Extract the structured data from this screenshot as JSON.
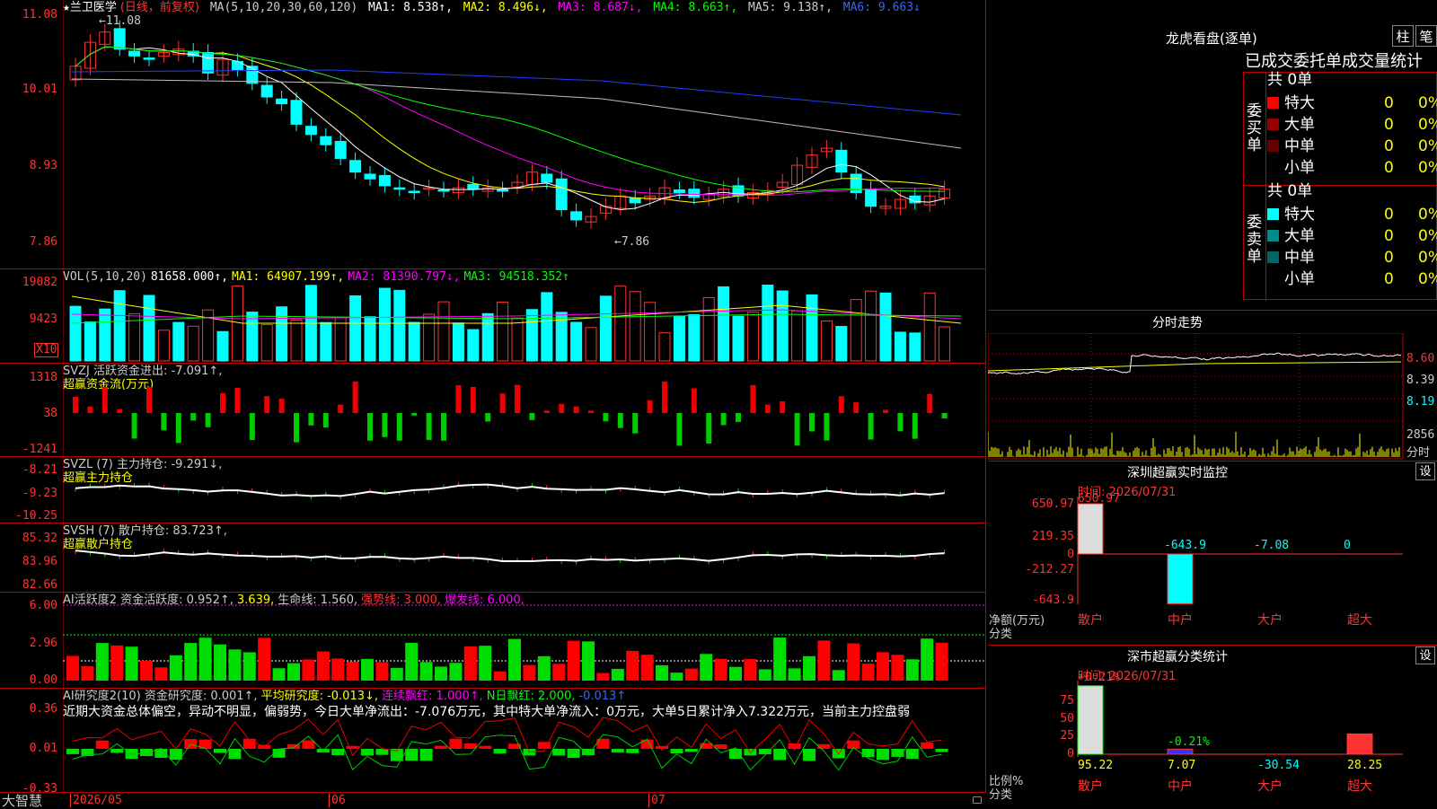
{
  "app": {
    "brand": "大智慧"
  },
  "stock": {
    "star": "★",
    "name": "兰卫医学",
    "period": "(日线，前复权)"
  },
  "main_chart": {
    "ma_label": "MA(5,10,20,30,60,120)",
    "ma1": "MA1: 8.538↑,",
    "ma2": "MA2: 8.496↓,",
    "ma3": "MA3: 8.687↓,",
    "ma4": "MA4: 8.663↑,",
    "ma5": "MA5: 9.138↑,",
    "ma6": "MA6: 9.663↓",
    "y_ticks": [
      "11.08",
      "10.01",
      "8.93",
      "7.86"
    ],
    "high_label": "←11.08",
    "low_label": "←7.86",
    "colors": {
      "up": "#ff3232",
      "down": "#00ffff",
      "ma1": "#ffffff",
      "ma2": "#ffff00",
      "ma3": "#ff00ff",
      "ma4": "#00ff00",
      "ma5": "#c0c0c0",
      "ma6": "#2040ff"
    }
  },
  "vol_chart": {
    "label": "VOL(5,10,20)",
    "v0": "81658.000↑,",
    "ma1": "MA1: 64907.199↑,",
    "ma2": "MA2: 81390.797↓,",
    "ma3": "MA3: 94518.352↑",
    "y_ticks": [
      "19082",
      "9423"
    ],
    "unit": "X10"
  },
  "svzj": {
    "label": "SVZJ  活跃资金进出: -7.091↑,",
    "sub": "超赢资金流(万元)",
    "y_ticks": [
      "1318",
      "38",
      "-1241"
    ]
  },
  "svzl": {
    "label": "SVZL (7) 主力持仓: -9.291↓,",
    "sub": "超赢主力持仓",
    "y_ticks": [
      "-8.21",
      "-9.23",
      "-10.25"
    ]
  },
  "svsh": {
    "label": "SVSH (7) 散户持仓: 83.723↑,",
    "sub": "超赢散户持仓",
    "y_ticks": [
      "85.32",
      "83.96",
      "82.66"
    ]
  },
  "ai_act": {
    "label": "AI活跃度2 资金活跃度: 0.952↑,",
    "v2": "3.639,",
    "v3": "生命线: 1.560,",
    "v4": "强势线: 3.000,",
    "v5": "爆发线: 6.000,",
    "y_ticks": [
      "6.00",
      "2.96",
      "0.00"
    ]
  },
  "ai_res": {
    "label": "AI研究度2(10) 资金研究度: 0.001↑,",
    "v2": "平均研究度: -0.013↓,",
    "v3": "连续飘红: 1.000↑,",
    "v4": "N日飘红: 2.000,",
    "v5": "-0.013↑",
    "summary": "近期大资金总体偏空，异动不明显，偏弱势，今日大单净流出：-7.076万元，其中特大单净流入：0万元，大单5日累计净入7.322万元，当前主力控盘弱",
    "y_ticks": [
      "0.36",
      "0.01",
      "-0.33"
    ]
  },
  "dates": [
    "2026/05",
    "06",
    "07"
  ],
  "dragon": {
    "title": "龙虎看盘(逐单)",
    "btn1": "柱",
    "btn2": "笔",
    "tabs": [
      "已成交",
      "委托单",
      "成交量统计"
    ],
    "buy_side": "委买单",
    "sell_side": "委卖单",
    "buy_total": "共 0单",
    "sell_total": "共 0单",
    "buy_rows": [
      {
        "name": "特大",
        "vol": "0",
        "pct": "0%",
        "color": "#ff0000"
      },
      {
        "name": "大单",
        "vol": "0",
        "pct": "0%",
        "color": "#990000"
      },
      {
        "name": "中单",
        "vol": "0",
        "pct": "0%",
        "color": "#660000"
      },
      {
        "name": "小单",
        "vol": "0",
        "pct": "0%",
        "color": ""
      }
    ],
    "sell_rows": [
      {
        "name": "特大",
        "vol": "0",
        "pct": "0%",
        "color": "#00ffff"
      },
      {
        "name": "大单",
        "vol": "0",
        "pct": "0%",
        "color": "#008b8b"
      },
      {
        "name": "中单",
        "vol": "0",
        "pct": "0%",
        "color": "#006666"
      },
      {
        "name": "小单",
        "vol": "0",
        "pct": "0%",
        "color": ""
      }
    ]
  },
  "intraday": {
    "title": "分时走势",
    "y_ticks": [
      "8.60",
      "8.39",
      "8.19"
    ],
    "vol_label": "2856",
    "vol_unit": "分时"
  },
  "sz_monitor": {
    "title": "深圳超赢实时监控",
    "set": "设",
    "time": "时间: 2026/07/31",
    "y_ticks": [
      "650.97",
      "219.35",
      "0",
      "-212.27",
      "-643.9"
    ],
    "unit": "净额(万元)",
    "cat_label": "分类",
    "categories": [
      "散户",
      "中户",
      "大户",
      "超大"
    ],
    "values": [
      650.97,
      -643.9,
      -7.08,
      0
    ],
    "value_labels": [
      "650.97",
      "-643.9",
      "-7.08",
      "0"
    ]
  },
  "sz_class": {
    "title": "深市超赢分类统计",
    "set": "设",
    "time": "时间: 2026/07/31",
    "y_ticks": [
      "75",
      "50",
      "25",
      "0"
    ],
    "unit": "比例%",
    "cat_label": "分类",
    "top_labels": [
      "+0.21%",
      "-0.21%"
    ],
    "categories": [
      "散户",
      "中户",
      "大户",
      "超大"
    ],
    "values": [
      95.22,
      7.07,
      -30.54,
      28.25
    ],
    "value_labels": [
      "95.22",
      "7.07",
      "-30.54",
      "28.25"
    ]
  }
}
